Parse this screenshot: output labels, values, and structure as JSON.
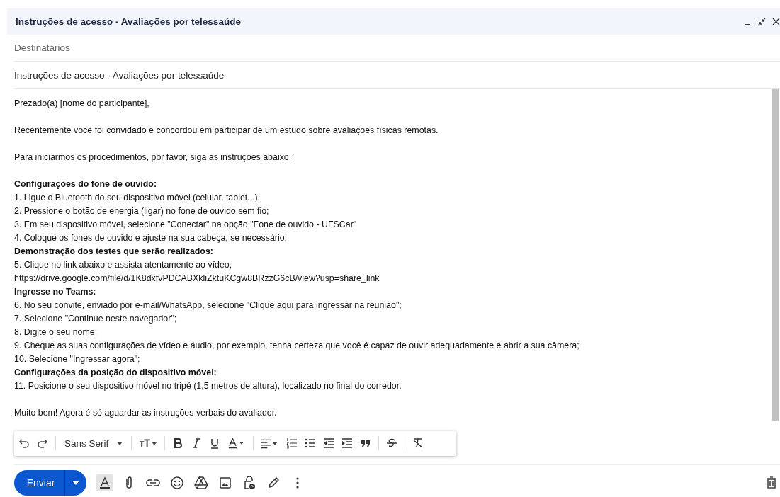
{
  "window": {
    "title": "Instruções de acesso - Avaliações por telessaúde"
  },
  "recipients": {
    "placeholder": "Destinatários"
  },
  "subject": {
    "value": "Instruções de acesso - Avaliações por telessaúde"
  },
  "body": [
    {
      "lines": [
        {
          "kind": "text",
          "text": "Prezado(a) [nome do participante],"
        }
      ]
    },
    {
      "lines": [
        {
          "kind": "text",
          "text": "Recentemente você foi convidado e concordou em participar de um estudo sobre avaliações físicas remotas."
        }
      ]
    },
    {
      "lines": [
        {
          "kind": "text",
          "text": "Para iniciarmos os procedimentos, por favor, siga as instruções abaixo:"
        }
      ]
    },
    {
      "lines": [
        {
          "kind": "heading",
          "text": "Configurações do fone de ouvido:"
        },
        {
          "kind": "text",
          "text": "1. Ligue o Bluetooth do seu dispositivo móvel (celular, tablet...);"
        },
        {
          "kind": "text",
          "text": "2. Pressione o botão de energia (ligar) no fone de ouvido sem fio;"
        },
        {
          "kind": "text",
          "text": "3. Em seu dispositivo móvel, selecione \"Conectar\" na opção \"Fone de ouvido - UFSCar\""
        },
        {
          "kind": "text",
          "text": "4. Coloque os fones de ouvido e ajuste na sua cabeça, se necessário;"
        },
        {
          "kind": "heading",
          "text": "Demonstração dos testes que serão realizados:"
        },
        {
          "kind": "text",
          "text": "5. Clique no link abaixo e assista atentamente ao vídeo;"
        },
        {
          "kind": "link",
          "text": "https://drive.google.com/file/d/1K8dxfvPDCABXkliZktuKCgw8BRzzG6cB/view?usp=share_link"
        },
        {
          "kind": "heading",
          "text": "Ingresse no Teams:"
        },
        {
          "kind": "text",
          "text": "6. No seu convite, enviado por e-mail/WhatsApp, selecione \"Clique aqui para ingressar na reunião\";"
        },
        {
          "kind": "text",
          "text": "7. Selecione \"Continue neste navegador\";"
        },
        {
          "kind": "text",
          "text": "8. Digite o seu nome;"
        },
        {
          "kind": "text",
          "text": "9. Cheque as suas configurações de vídeo e áudio, por exemplo, tenha certeza que você é capaz de ouvir adequadamente e abrir a sua câmera;"
        },
        {
          "kind": "text",
          "text": "10. Selecione \"Ingressar agora\";"
        },
        {
          "kind": "heading",
          "text": "Configurações da posição do dispositivo móvel:"
        },
        {
          "kind": "text",
          "text": "11. Posicione o seu dispositivo móvel no tripé (1,5 metros de altura), localizado no final do corredor."
        }
      ]
    },
    {
      "lines": [
        {
          "kind": "text",
          "text": "Muito bem! Agora é só aguardar as instruções verbais do avaliador."
        }
      ]
    }
  ],
  "format_toolbar": {
    "font": "Sans Serif"
  },
  "send_button": {
    "label": "Enviar"
  },
  "format_toggle": {
    "selected": true
  }
}
